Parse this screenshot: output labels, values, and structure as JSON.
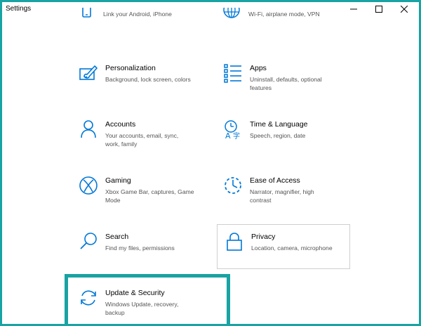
{
  "window": {
    "title": "Settings",
    "controls": [
      "minimize",
      "maximize",
      "close"
    ]
  },
  "tiles": [
    {
      "key": "phone",
      "name": "",
      "desc": "Link your Android, iPhone",
      "icon": "phone-icon"
    },
    {
      "key": "network",
      "name": "",
      "desc": "Wi-Fi, airplane mode, VPN",
      "icon": "globe-icon"
    },
    {
      "key": "personalization",
      "name": "Personalization",
      "desc": "Background, lock screen, colors",
      "icon": "paintbrush-icon"
    },
    {
      "key": "apps",
      "name": "Apps",
      "desc": "Uninstall, defaults, optional features",
      "icon": "apps-list-icon"
    },
    {
      "key": "accounts",
      "name": "Accounts",
      "desc": "Your accounts, email, sync, work, family",
      "icon": "person-icon"
    },
    {
      "key": "time",
      "name": "Time & Language",
      "desc": "Speech, region, date",
      "icon": "time-language-icon"
    },
    {
      "key": "gaming",
      "name": "Gaming",
      "desc": "Xbox Game Bar, captures, Game Mode",
      "icon": "xbox-icon"
    },
    {
      "key": "ease",
      "name": "Ease of Access",
      "desc": "Narrator, magnifier, high contrast",
      "icon": "ease-of-access-icon"
    },
    {
      "key": "search",
      "name": "Search",
      "desc": "Find my files, permissions",
      "icon": "magnifier-icon"
    },
    {
      "key": "privacy",
      "name": "Privacy",
      "desc": "Location, camera, microphone",
      "icon": "lock-icon"
    },
    {
      "key": "update",
      "name": "Update & Security",
      "desc": "Windows Update, recovery, backup",
      "icon": "sync-arrows-icon"
    }
  ],
  "colors": {
    "accent": "#0078d7",
    "highlight_border": "#19a3a3",
    "description_text": "#555555"
  }
}
